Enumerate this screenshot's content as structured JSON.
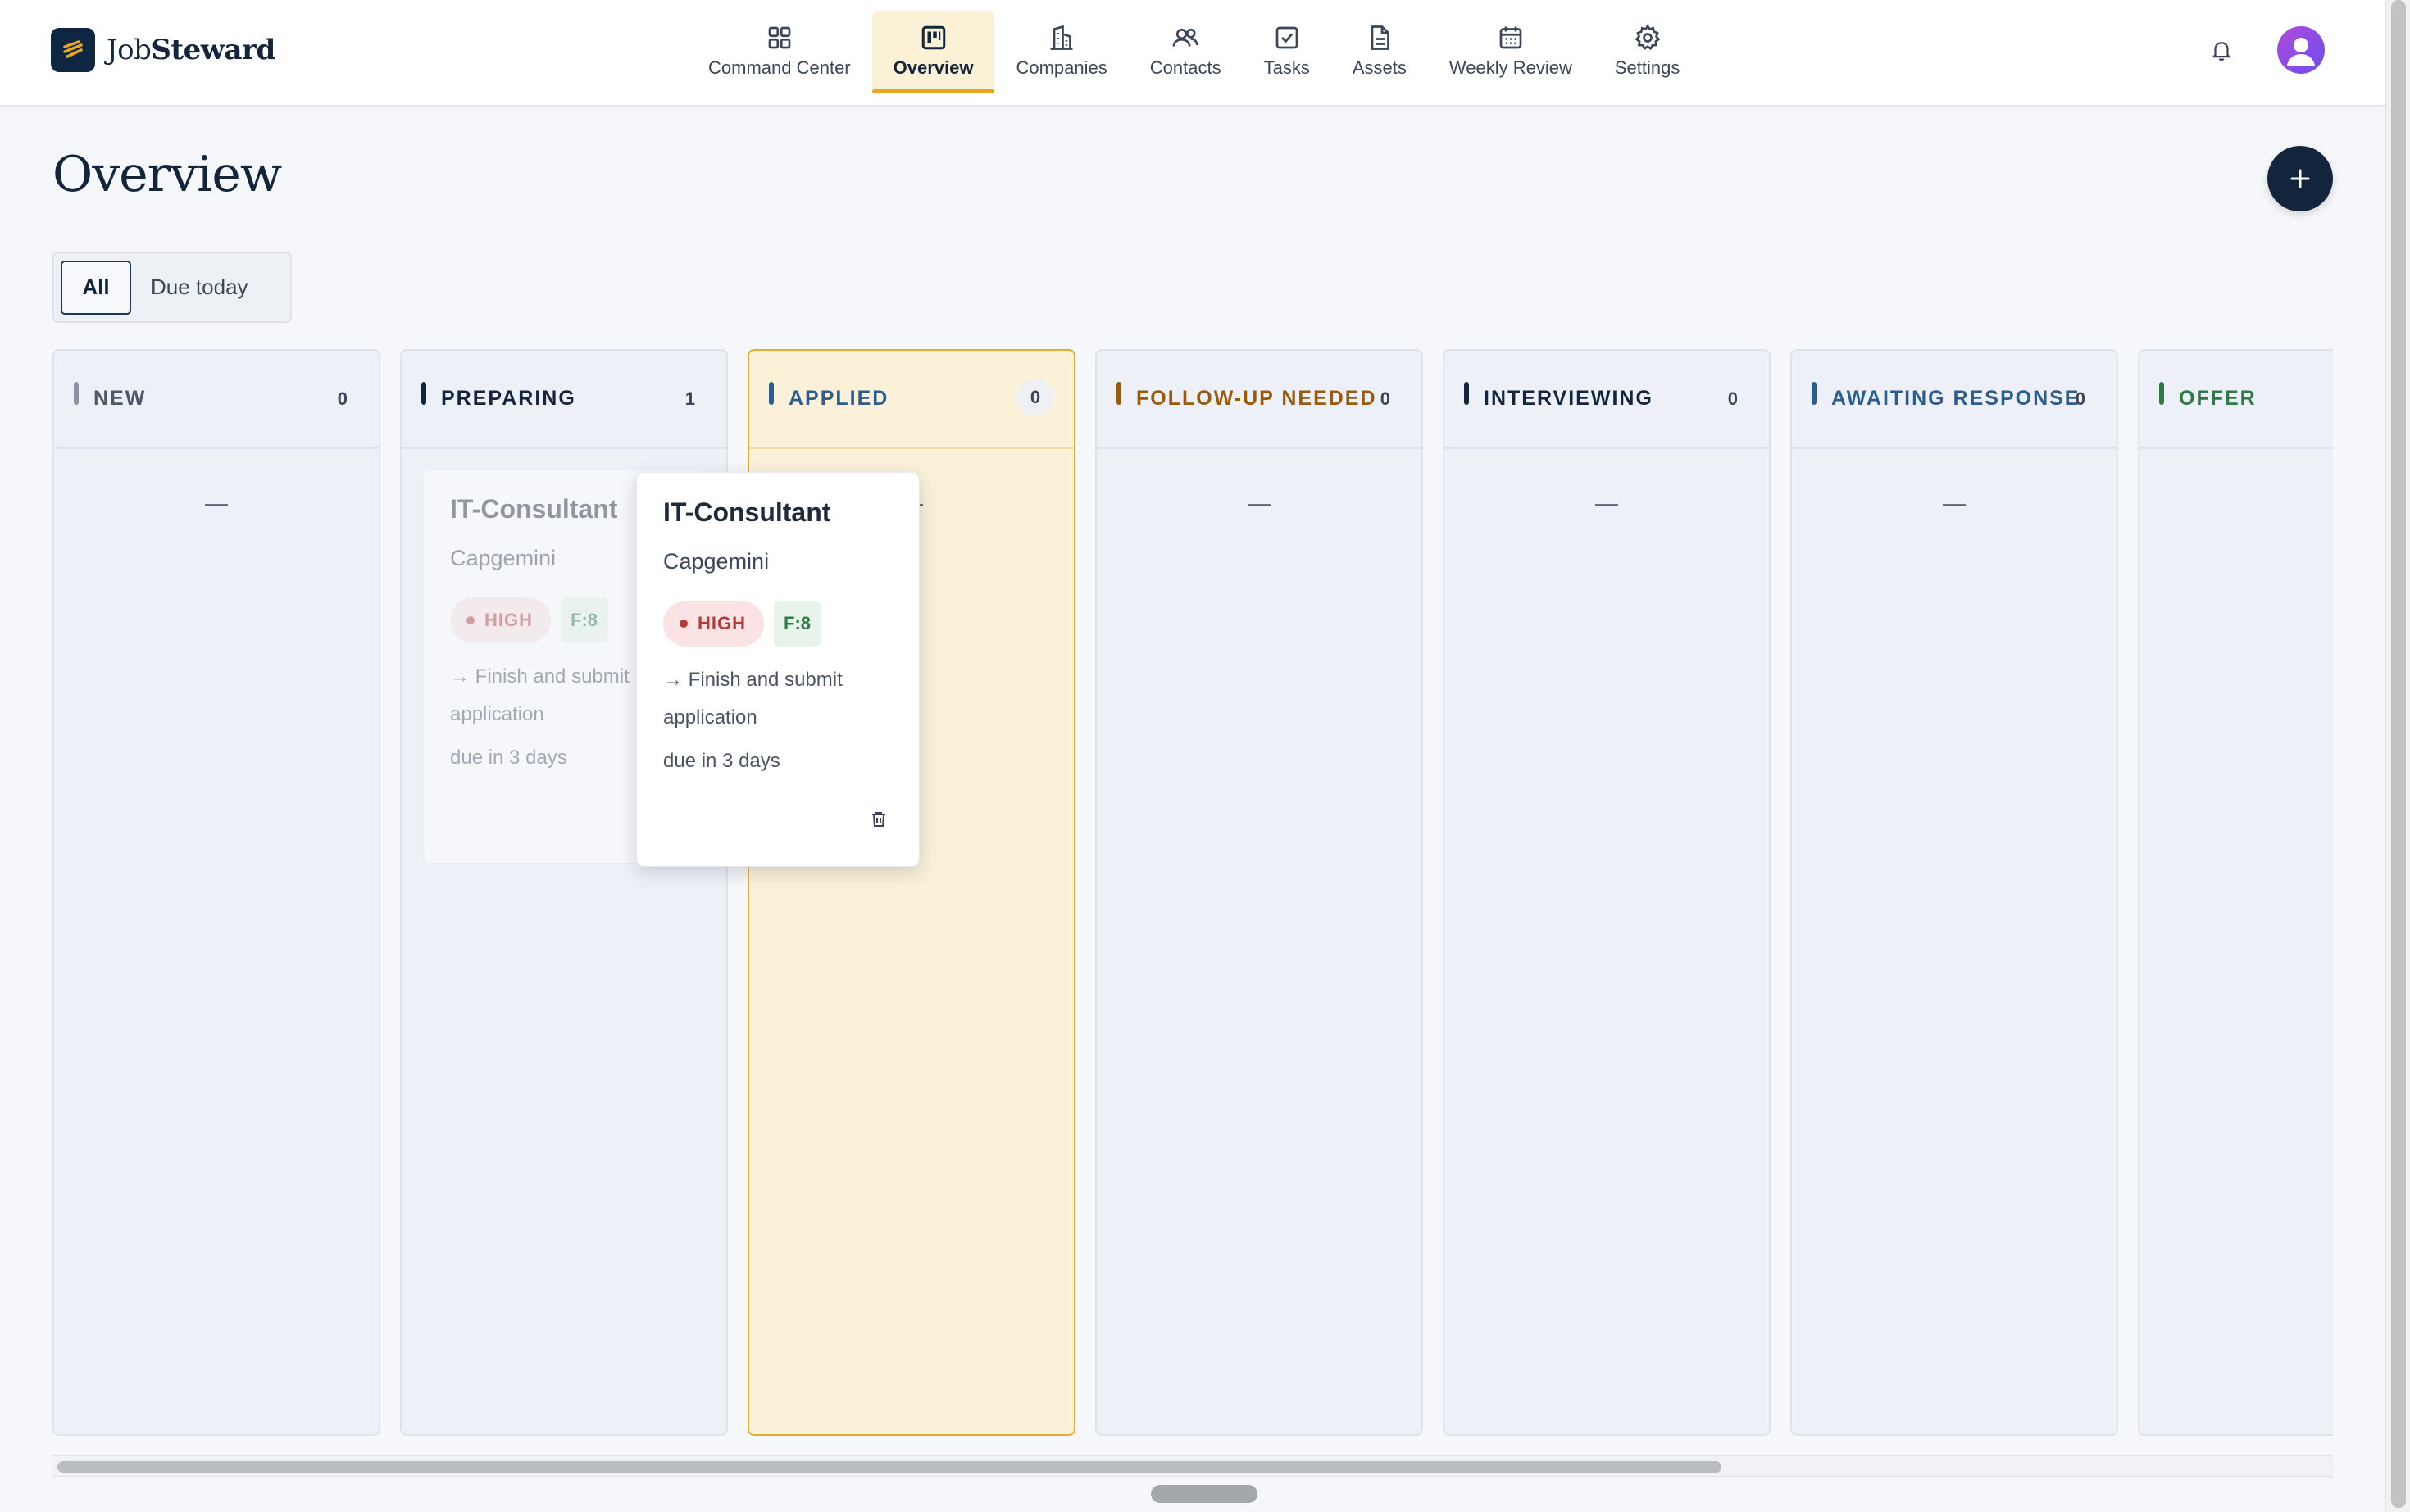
{
  "app": {
    "brand_prefix": "Job",
    "brand_suffix": "Steward"
  },
  "nav": {
    "items": [
      {
        "label": "Command Center",
        "icon": "grid-icon"
      },
      {
        "label": "Overview",
        "icon": "kanban-icon",
        "active": true
      },
      {
        "label": "Companies",
        "icon": "building-icon"
      },
      {
        "label": "Contacts",
        "icon": "users-icon"
      },
      {
        "label": "Tasks",
        "icon": "checkbox-icon"
      },
      {
        "label": "Assets",
        "icon": "document-icon"
      },
      {
        "label": "Weekly Review",
        "icon": "calendar-icon"
      },
      {
        "label": "Settings",
        "icon": "gear-icon"
      }
    ]
  },
  "page": {
    "title": "Overview",
    "add_icon": "+"
  },
  "filters": {
    "all": "All",
    "due_today": "Due today",
    "selected": "All"
  },
  "columns": [
    {
      "title": "NEW",
      "count": "0",
      "empty": "—",
      "color": "#5b6474"
    },
    {
      "title": "PREPARING",
      "count": "1",
      "empty": "",
      "color": "#13253d"
    },
    {
      "title": "APPLIED",
      "count": "0",
      "empty": "—",
      "color": "#2c5d8f"
    },
    {
      "title": "FOLLOW-UP NEEDED",
      "count": "0",
      "empty": "—",
      "color": "#9a5a0c"
    },
    {
      "title": "INTERVIEWING",
      "count": "0",
      "empty": "—",
      "color": "#13253d"
    },
    {
      "title": "AWAITING RESPONSE",
      "count": "0",
      "empty": "—",
      "color": "#2c5d8f"
    },
    {
      "title": "OFFER",
      "count": "",
      "empty": "—",
      "color": "#2e7a44"
    }
  ],
  "card": {
    "title": "IT-Consultant",
    "company": "Capgemini",
    "priority": "HIGH",
    "fit": "F:8",
    "next_action": "→ Finish and submit application",
    "due": "due in 3 days"
  },
  "colors": {
    "accent": "#e8a623",
    "brand": "#13253d",
    "highlight_bg": "#fbf1d9",
    "high_priority": "#b23a3a",
    "fit_green": "#2e7a44"
  }
}
